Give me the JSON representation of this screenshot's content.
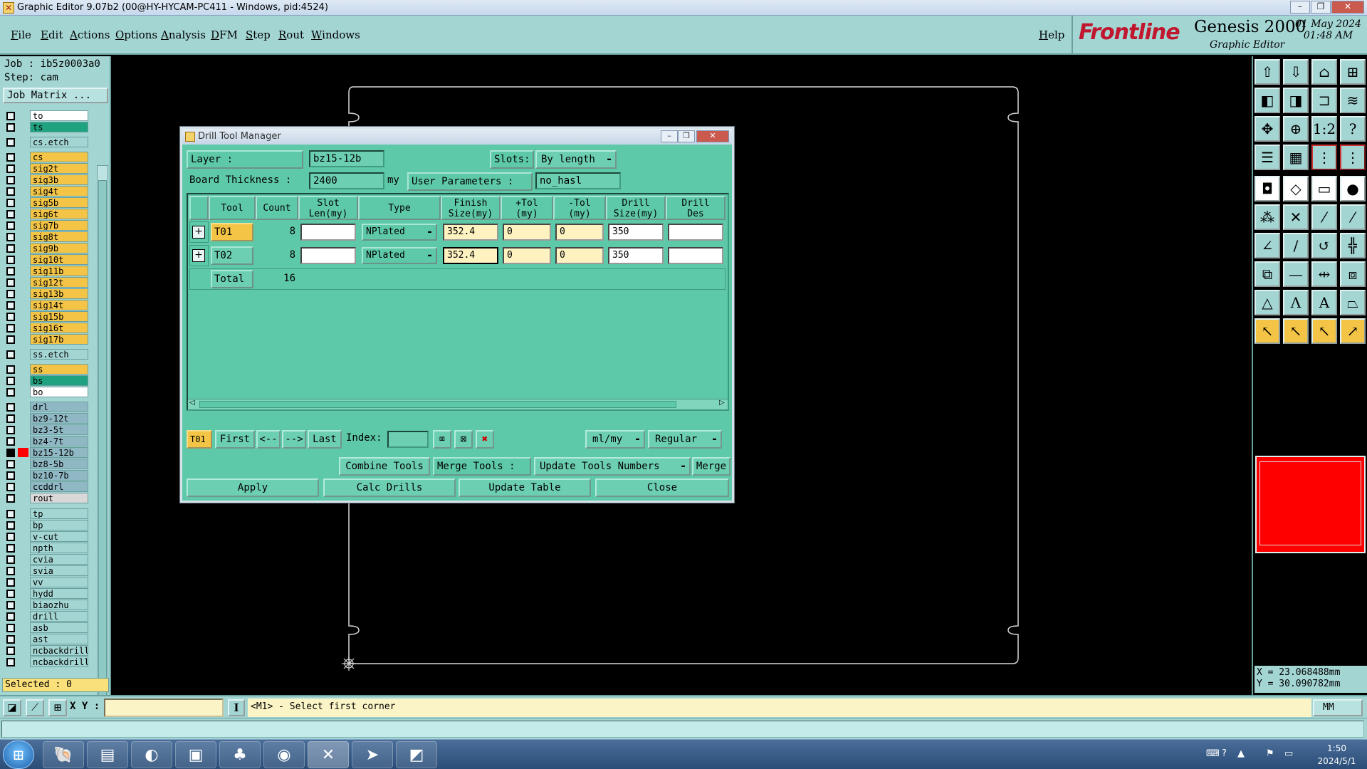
{
  "window": {
    "title": "Graphic Editor 9.07b2 (00@HY-HYCAM-PC411 - Windows, pid:4524)"
  },
  "menu": {
    "items": [
      "File",
      "Edit",
      "Actions",
      "Options",
      "Analysis",
      "DFM",
      "Step",
      "Rout",
      "Windows"
    ],
    "help": "Help"
  },
  "brand": {
    "logo": "Frontline",
    "product": "Genesis 2000",
    "subtitle": "Graphic Editor",
    "date": "01 May 2024",
    "time": "01:48 AM"
  },
  "job": {
    "job_line": "Job : ib5z0003a0",
    "step_line": "Step: cam",
    "matrix_button": "Job Matrix ..."
  },
  "layers": [
    {
      "name": "to",
      "color": "#ffffff"
    },
    {
      "name": "ts",
      "color": "#1fa27f"
    },
    {
      "name": "cs.etch",
      "color": "#a3d5d3"
    },
    {
      "name": "cs",
      "color": "#f3c446"
    },
    {
      "name": "sig2t",
      "color": "#f3c446"
    },
    {
      "name": "sig3b",
      "color": "#f3c446"
    },
    {
      "name": "sig4t",
      "color": "#f3c446"
    },
    {
      "name": "sig5b",
      "color": "#f3c446"
    },
    {
      "name": "sig6t",
      "color": "#f3c446"
    },
    {
      "name": "sig7b",
      "color": "#f3c446"
    },
    {
      "name": "sig8t",
      "color": "#f3c446"
    },
    {
      "name": "sig9b",
      "color": "#f3c446"
    },
    {
      "name": "sig10t",
      "color": "#f3c446"
    },
    {
      "name": "sig11b",
      "color": "#f3c446"
    },
    {
      "name": "sig12t",
      "color": "#f3c446"
    },
    {
      "name": "sig13b",
      "color": "#f3c446"
    },
    {
      "name": "sig14t",
      "color": "#f3c446"
    },
    {
      "name": "sig15b",
      "color": "#f3c446"
    },
    {
      "name": "sig16t",
      "color": "#f3c446"
    },
    {
      "name": "sig17b",
      "color": "#f3c446"
    },
    {
      "name": "ss.etch",
      "color": "#a3d5d3"
    },
    {
      "name": "ss",
      "color": "#f3c446"
    },
    {
      "name": "bs",
      "color": "#1fa27f"
    },
    {
      "name": "bo",
      "color": "#ffffff"
    },
    {
      "name": "drl",
      "color": "#8fb8c4"
    },
    {
      "name": "bz9-12t",
      "color": "#8fb8c4"
    },
    {
      "name": "bz3-5t",
      "color": "#8fb8c4"
    },
    {
      "name": "bz4-7t",
      "color": "#8fb8c4"
    },
    {
      "name": "bz15-12b",
      "color": "#8fb8c4"
    },
    {
      "name": "bz8-5b",
      "color": "#8fb8c4"
    },
    {
      "name": "bz10-7b",
      "color": "#8fb8c4"
    },
    {
      "name": "ccddrl",
      "color": "#8fb8c4"
    },
    {
      "name": "rout",
      "color": "#d8d8d8"
    },
    {
      "name": "tp",
      "color": "#a3d5d3"
    },
    {
      "name": "bp",
      "color": "#a3d5d3"
    },
    {
      "name": "v-cut",
      "color": "#a3d5d3"
    },
    {
      "name": "npth",
      "color": "#a3d5d3"
    },
    {
      "name": "cvia",
      "color": "#a3d5d3"
    },
    {
      "name": "svia",
      "color": "#a3d5d3"
    },
    {
      "name": "vv",
      "color": "#a3d5d3"
    },
    {
      "name": "hydd",
      "color": "#a3d5d3"
    },
    {
      "name": "biaozhu",
      "color": "#a3d5d3"
    },
    {
      "name": "drill",
      "color": "#a3d5d3"
    },
    {
      "name": "asb",
      "color": "#a3d5d3"
    },
    {
      "name": "ast",
      "color": "#a3d5d3"
    },
    {
      "name": "ncbackdrill-",
      "color": "#a3d5d3"
    },
    {
      "name": "ncbackdrill-",
      "color": "#a3d5d3"
    }
  ],
  "selected_count": "Selected : 0",
  "coords": {
    "x": "X = 23.068488mm",
    "y": "Y = 30.090782mm"
  },
  "status": {
    "xy_label": "X Y :",
    "xy_value": "",
    "prompt": "<M1> - Select first corner",
    "units": "MM"
  },
  "dialog": {
    "title": "Drill Tool Manager",
    "layer_label": "Layer                :",
    "layer_value": "bz15-12b",
    "slots_label": "Slots:",
    "slots_value": "By length",
    "thickness_label": "Board Thickness :",
    "thickness_value": "2400",
    "thickness_unit": "my",
    "user_params_label": "User Parameters :",
    "user_params_value": "no_hasl",
    "columns": [
      {
        "l1": "",
        "l2": ""
      },
      {
        "l1": "Tool",
        "l2": ""
      },
      {
        "l1": "Count",
        "l2": ""
      },
      {
        "l1": "Slot",
        "l2": "Len(my)"
      },
      {
        "l1": "Type",
        "l2": ""
      },
      {
        "l1": "Finish",
        "l2": "Size(my)"
      },
      {
        "l1": "+Tol",
        "l2": "(my)"
      },
      {
        "l1": "-Tol",
        "l2": "(my)"
      },
      {
        "l1": "Drill",
        "l2": "Size(my)"
      },
      {
        "l1": "Drill",
        "l2": "Des"
      }
    ],
    "rows": [
      {
        "tool": "T01",
        "count": "8",
        "slot_len": "",
        "type": "NPlated",
        "finish": "352.4",
        "ptol": "0",
        "mtol": "0",
        "drill": "350",
        "des": ""
      },
      {
        "tool": "T02",
        "count": "8",
        "slot_len": "",
        "type": "NPlated",
        "finish": "352.4",
        "ptol": "0",
        "mtol": "0",
        "drill": "350",
        "des": ""
      }
    ],
    "total_label": "Total",
    "total_count": "16",
    "current_tool": "T01",
    "nav": {
      "first": "First",
      "prev": "<--",
      "next": "-->",
      "last": "Last",
      "index_label": "Index:",
      "index_value": ""
    },
    "units_select": "ml/my",
    "mode_select": "Regular",
    "combine_tools": "Combine Tools",
    "merge_tools_label": "Merge Tools :",
    "update_tools_numbers": "Update Tools Numbers",
    "merge": "Merge",
    "apply": "Apply",
    "calc_drills": "Calc Drills",
    "update_table": "Update Table",
    "close": "Close"
  },
  "taskbar": {
    "time": "1:50",
    "date": "2024/5/1"
  },
  "colors": {
    "panel": "#a3d5d3",
    "dialog": "#5ec9a8",
    "accent_yellow": "#f3c446",
    "minimap": "#ff0000"
  }
}
